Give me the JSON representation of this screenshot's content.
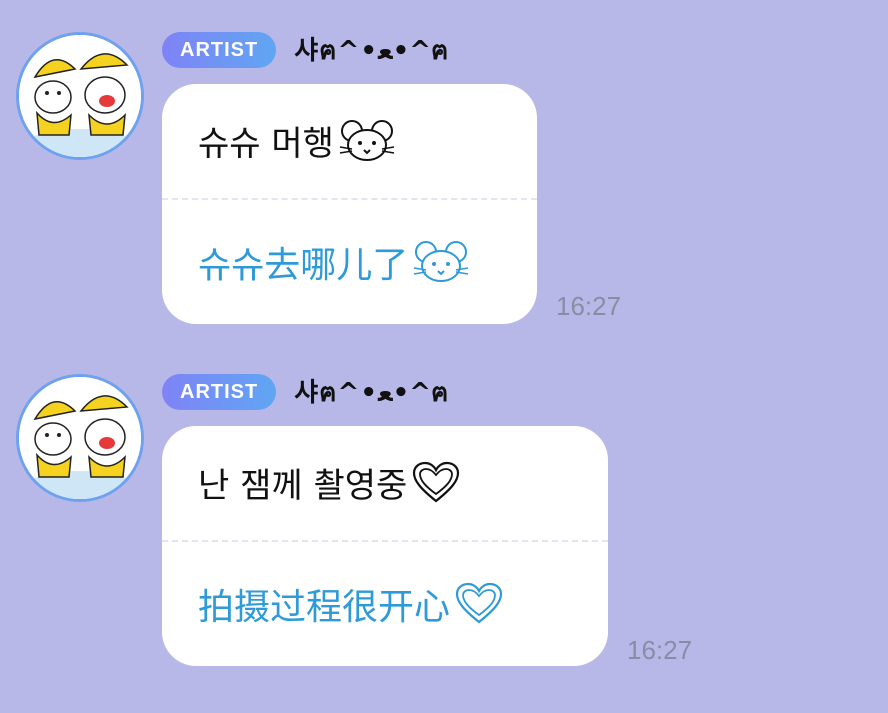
{
  "chat": {
    "messages": [
      {
        "badge": "ARTIST",
        "sender": "샤ฅ^•ﻌ•^ฅ",
        "korean": "슈슈 머행",
        "translation": "슈슈去哪儿了",
        "emoji": "mouse-face-icon",
        "time": "16:27"
      },
      {
        "badge": "ARTIST",
        "sender": "샤ฅ^•ﻌ•^ฅ",
        "korean": "난 잼께 촬영중",
        "translation": "拍摄过程很开心",
        "emoji": "heart-outline-icon",
        "time": "16:27"
      }
    ]
  },
  "colors": {
    "background": "#b8b8e8",
    "badge_gradient_start": "#7f83f6",
    "badge_gradient_end": "#5fa6f3",
    "translation_text": "#2f9ad8",
    "timestamp": "#8b8ba6",
    "avatar_ring": "#6fa2ee"
  }
}
